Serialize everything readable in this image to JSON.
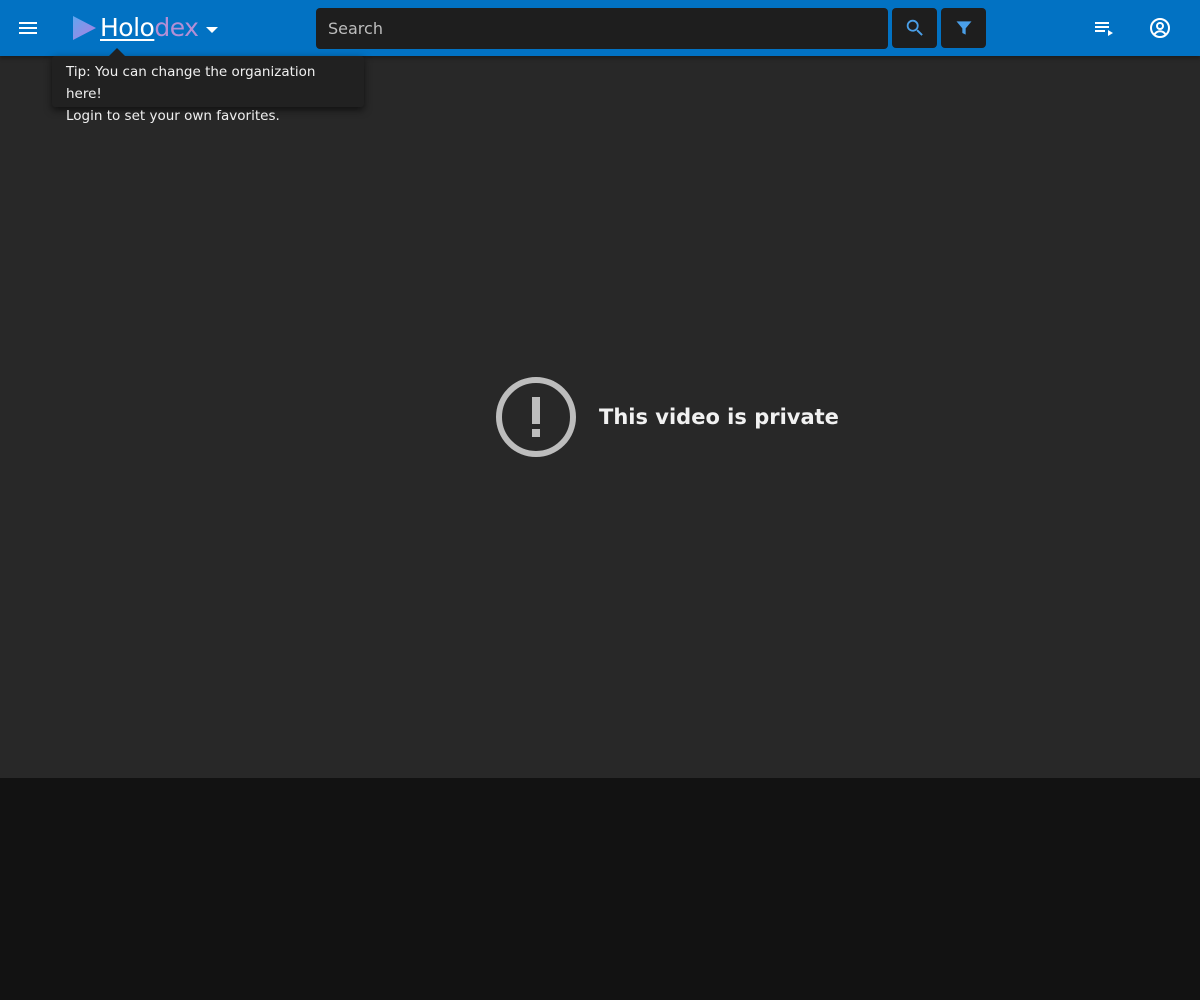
{
  "app": {
    "brand_part1": "Holo",
    "brand_part2": "dex",
    "brand_color_primary": "#0272c3",
    "brand_color_dex": "#b38fd6"
  },
  "header": {
    "menu_icon": "hamburger-menu-icon",
    "org_dropdown_icon": "caret-down-icon",
    "search": {
      "placeholder": "Search",
      "value": ""
    },
    "search_icon": "magnifier-icon",
    "filter_icon": "funnel-icon",
    "queue_icon": "playlist-play-icon",
    "account_icon": "account-circle-icon"
  },
  "tooltip": {
    "line1": "Tip: You can change the organization here!",
    "line2": "Login to set your own favorites."
  },
  "player": {
    "error_icon": "exclamation-circle-icon",
    "error_message": "This video is private"
  }
}
